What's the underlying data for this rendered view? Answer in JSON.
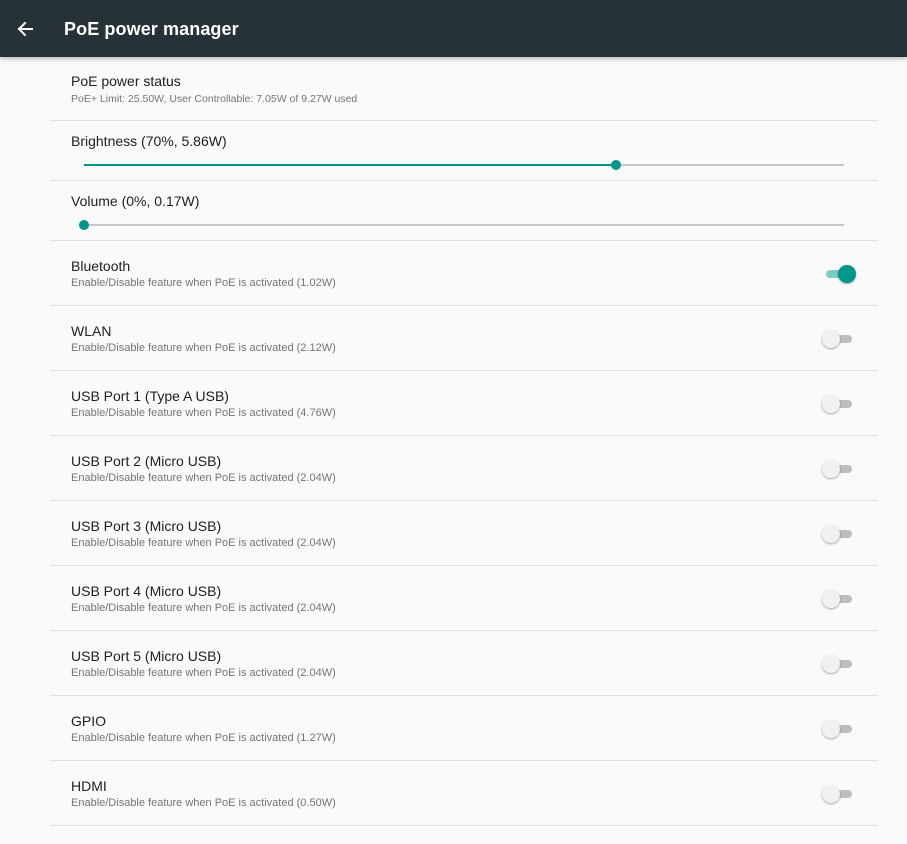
{
  "app_bar": {
    "title": "PoE power manager",
    "back_icon": "arrow-back-icon"
  },
  "status": {
    "title": "PoE power status",
    "summary": "PoE+ Limit: 25.50W, User Controllable: 7.05W of 9.27W used"
  },
  "brightness": {
    "title": "Brightness (70%, 5.86W)",
    "value_percent": 70
  },
  "volume": {
    "title": "Volume (0%, 0.17W)",
    "value_percent": 0
  },
  "features": [
    {
      "title": "Bluetooth",
      "summary": "Enable/Disable feature when PoE is activated (1.02W)",
      "enabled": true
    },
    {
      "title": "WLAN",
      "summary": "Enable/Disable feature when PoE is activated (2.12W)",
      "enabled": false
    },
    {
      "title": "USB Port 1 (Type A USB)",
      "summary": "Enable/Disable feature when PoE is activated (4.76W)",
      "enabled": false
    },
    {
      "title": "USB Port 2 (Micro USB)",
      "summary": "Enable/Disable feature when PoE is activated (2.04W)",
      "enabled": false
    },
    {
      "title": "USB Port 3 (Micro USB)",
      "summary": "Enable/Disable feature when PoE is activated (2.04W)",
      "enabled": false
    },
    {
      "title": "USB Port 4 (Micro USB)",
      "summary": "Enable/Disable feature when PoE is activated (2.04W)",
      "enabled": false
    },
    {
      "title": "USB Port 5 (Micro USB)",
      "summary": "Enable/Disable feature when PoE is activated (2.04W)",
      "enabled": false
    },
    {
      "title": "GPIO",
      "summary": "Enable/Disable feature when PoE is activated (1.27W)",
      "enabled": false
    },
    {
      "title": "HDMI",
      "summary": "Enable/Disable feature when PoE is activated (0.50W)",
      "enabled": false
    }
  ],
  "colors": {
    "app_bar": "#263238",
    "accent": "#009688",
    "accent_light": "#80cbc4",
    "background": "#fafafa",
    "divider": "#e0e0e0"
  }
}
